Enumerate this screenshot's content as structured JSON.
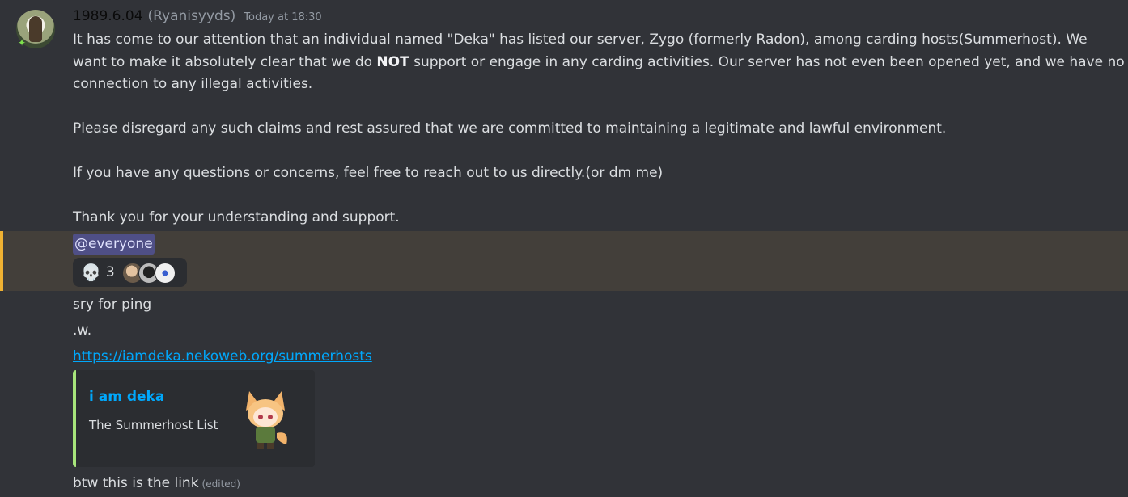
{
  "message1": {
    "username": "1989.6.04",
    "nickname": "(Ryanisyyds)",
    "timestamp": "Today at 18:30",
    "para1_a": "It has come to our attention that an individual named \"Deka\" has listed our server, Zygo (formerly Radon), among carding hosts(Summerhost). We want to make it absolutely clear that we do ",
    "para1_bold": "NOT",
    "para1_b": " support or engage in any carding activities. Our server has not even been opened yet, and we have no connection to any illegal activities.",
    "para2": "Please disregard any such claims and rest assured that we are committed to maintaining a legitimate and lawful environment.",
    "para3": "If you have any questions or concerns, feel free to reach out to us directly.(or dm me)",
    "para4": "Thank you for your understanding and support.",
    "mention": "@everyone",
    "reaction": {
      "emoji": "💀",
      "emoji_name": "skull-icon",
      "count": "3"
    }
  },
  "followups": {
    "line1": "sry for ping",
    "line2": ".w.",
    "url": "https://iamdeka.nekoweb.org/summerhosts",
    "embed": {
      "title": "i am deka",
      "description": "The Summerhost List"
    },
    "last_line": "btw this is the link",
    "edited": "(edited)"
  },
  "colors": {
    "background": "#313338",
    "mention_highlight": "#433f3a",
    "mention_border": "#f0b232",
    "link": "#00a8fc",
    "embed_border": "#a7e57b"
  }
}
